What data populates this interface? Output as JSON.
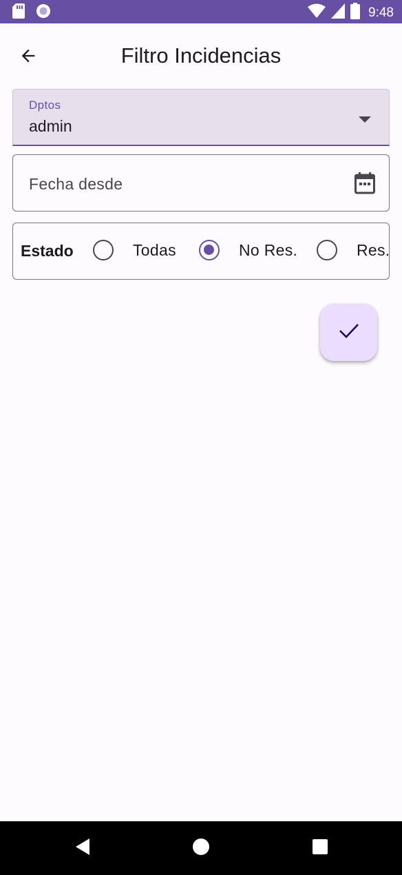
{
  "status_bar": {
    "time": "9:48",
    "icons": [
      "sd-card-icon",
      "circle-notification-icon",
      "wifi-icon",
      "signal-icon",
      "battery-icon"
    ]
  },
  "app_bar": {
    "title": "Filtro Incidencias",
    "back_icon": "arrow-back-icon"
  },
  "form": {
    "department": {
      "label": "Dptos",
      "value": "admin",
      "icon": "dropdown-arrow-icon"
    },
    "date_from": {
      "placeholder": "Fecha desde",
      "icon": "calendar-icon"
    },
    "status": {
      "label": "Estado",
      "options": [
        {
          "label": "Todas",
          "selected": false
        },
        {
          "label": "No Res.",
          "selected": true
        },
        {
          "label": "Res.",
          "selected": false
        }
      ]
    }
  },
  "fab": {
    "icon": "check-icon"
  },
  "nav_bar": {
    "icons": [
      "back-triangle-icon",
      "home-circle-icon",
      "recents-square-icon"
    ]
  },
  "colors": {
    "primary": "#6750a4",
    "surface": "#fdfbfe",
    "filled_field_bg": "#e7e0ec",
    "fab_bg": "#eaddff",
    "outline": "#79747e"
  }
}
